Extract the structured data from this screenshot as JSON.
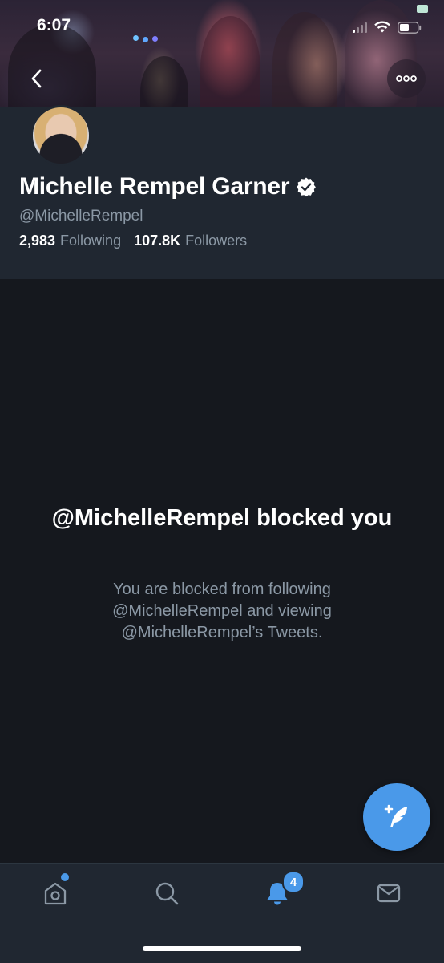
{
  "status_bar": {
    "time": "6:07"
  },
  "profile": {
    "display_name": "Michelle Rempel Garner",
    "handle": "@MichelleRempel",
    "following_count": "2,983",
    "following_label": "Following",
    "followers_count": "107.8K",
    "followers_label": "Followers",
    "verified": true
  },
  "blocked": {
    "title": "@MichelleRempel blocked you",
    "description": "You are blocked from following @MichelleRempel and viewing @MichelleRempel’s Tweets."
  },
  "tabbar": {
    "notifications_badge": "4",
    "items": [
      "home-icon",
      "search-icon",
      "bell-icon",
      "mail-icon"
    ]
  },
  "colors": {
    "accent": "#4a99e9",
    "background": "#15181e",
    "header_bg": "#202731",
    "secondary_text": "#8b98a5"
  }
}
